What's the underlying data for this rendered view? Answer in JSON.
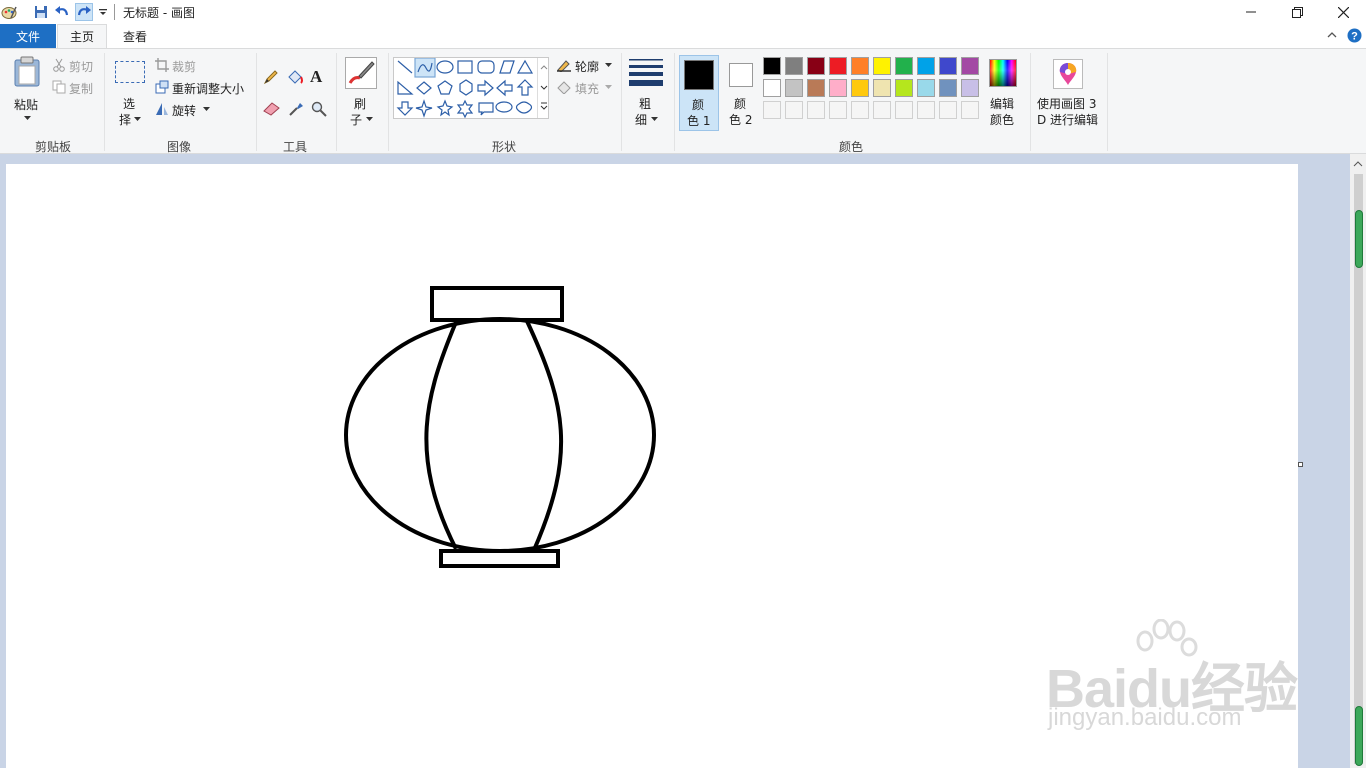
{
  "titlebar": {
    "title": "无标题 - 画图",
    "icons": [
      "paint-app-icon",
      "save-icon",
      "undo-icon",
      "redo-icon",
      "customize-qa-icon"
    ]
  },
  "tabs": {
    "file": "文件",
    "home": "主页",
    "view": "查看"
  },
  "clipboard": {
    "paste": "粘贴",
    "cut": "剪切",
    "copy": "复制",
    "group": "剪贴板"
  },
  "image": {
    "select_1": "选",
    "select_2": "择",
    "crop": "裁剪",
    "resize": "重新调整大小",
    "rotate": "旋转",
    "group": "图像"
  },
  "tools": {
    "group": "工具"
  },
  "brushes": {
    "label_1": "刷",
    "label_2": "子"
  },
  "shapes": {
    "outline": "轮廓",
    "fill": "填充",
    "group": "形状"
  },
  "size": {
    "label_1": "粗",
    "label_2": "细"
  },
  "colors": {
    "color1_1": "颜",
    "color1_2": "色 1",
    "color2_1": "颜",
    "color2_2": "色 2",
    "edit_1": "编辑",
    "edit_2": "颜色",
    "group": "颜色",
    "color1": "#000000",
    "color2": "#ffffff",
    "palette_row1": [
      "#000000",
      "#7f7f7f",
      "#880015",
      "#ed1c24",
      "#ff7f27",
      "#fff200",
      "#22b14c",
      "#00a2e8",
      "#3f48cc",
      "#a349a4"
    ],
    "palette_row2": [
      "#ffffff",
      "#c3c3c3",
      "#b97a57",
      "#ffaec9",
      "#ffc90e",
      "#efe4b0",
      "#b5e61d",
      "#99d9ea",
      "#7092be",
      "#c8bfe7"
    ],
    "palette_row3": [
      "#f5f5f5",
      "#f5f5f5",
      "#f5f5f5",
      "#f5f5f5",
      "#f5f5f5",
      "#f5f5f5",
      "#f5f5f5",
      "#f5f5f5",
      "#f5f5f5",
      "#f5f5f5"
    ]
  },
  "paint3d": {
    "label_1": "使用画图 3",
    "label_2": "D 进行编辑"
  },
  "watermark": {
    "brand": "Baidu经验",
    "url": "jingyan.baidu.com"
  }
}
